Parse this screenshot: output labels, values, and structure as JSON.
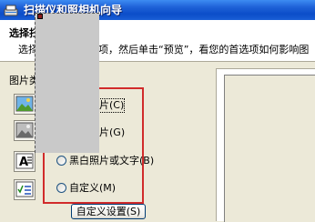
{
  "window": {
    "title": "扫描仪和照相机向导"
  },
  "header": {
    "title": "选择扫描首选项",
    "subtitle": "选择您的扫描首选项，然后单击“预览”，看您的首选项如何影响图"
  },
  "picture_type": {
    "label": "图片类型:",
    "options": [
      {
        "label": "彩色照片(C)",
        "selected": true,
        "icon": "color-photo-icon"
      },
      {
        "label": "灰度照片(G)",
        "selected": false,
        "icon": "grayscale-photo-icon"
      },
      {
        "label": "黑白照片或文字(B)",
        "selected": false,
        "icon": "bw-text-icon"
      },
      {
        "label": "自定义(M)",
        "selected": false,
        "icon": "custom-settings-icon"
      }
    ]
  },
  "custom_settings_button": {
    "label": "自定义设置(S)"
  },
  "colors": {
    "highlight_frame": "#d12b2b",
    "titlebar": "#0b4dc9",
    "radio_selected": "#21a121"
  }
}
